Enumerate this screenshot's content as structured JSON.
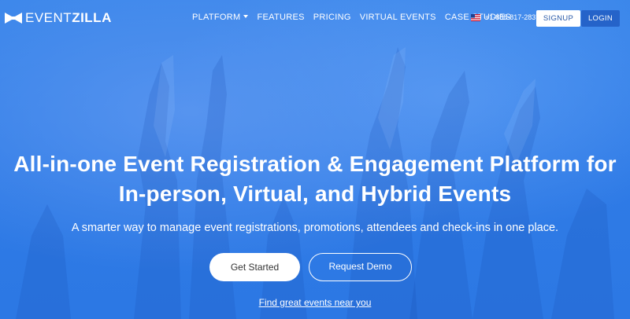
{
  "logo": {
    "brand_light": "EVENT",
    "brand_bold": "ZILLA"
  },
  "nav": {
    "items": [
      {
        "label": "PLATFORM",
        "has_dropdown": true
      },
      {
        "label": "FEATURES"
      },
      {
        "label": "PRICING"
      },
      {
        "label": "VIRTUAL EVENTS"
      },
      {
        "label": "CASE STUDIES"
      }
    ]
  },
  "contact": {
    "flag_icon": "us-flag-icon",
    "phone": "+1-888-817-2837"
  },
  "auth": {
    "signup_label": "SIGNUP",
    "login_label": "LOGIN"
  },
  "hero": {
    "headline_line1": "All-in-one Event Registration & Engagement Platform for",
    "headline_line2": "In-person, Virtual, and Hybrid Events",
    "subline": "A smarter way to manage event registrations, promotions, attendees and check-ins in one place.",
    "primary_cta": "Get Started",
    "secondary_cta": "Request Demo",
    "link": "Find great events near you"
  },
  "colors": {
    "hero_blue": "#2f7ae6",
    "login_bg": "#2563c9",
    "signup_text": "#2a5aa8"
  }
}
